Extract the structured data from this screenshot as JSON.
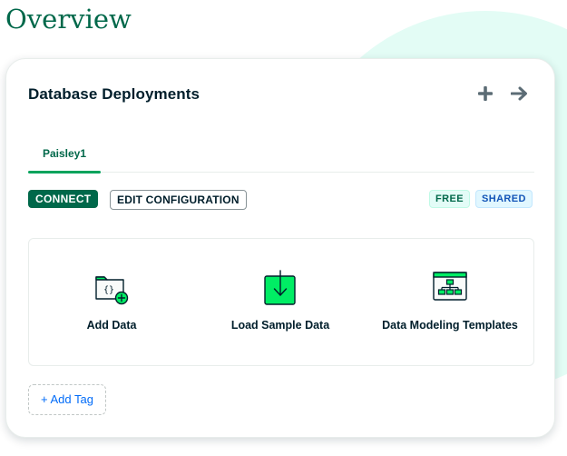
{
  "page": {
    "title": "Overview"
  },
  "deployments": {
    "title": "Database Deployments",
    "add_icon": "plus-icon",
    "view_all_icon": "arrow-right-icon",
    "tabs": [
      {
        "label": "Paisley1",
        "active": true
      }
    ],
    "actions": {
      "connect_label": "CONNECT",
      "edit_label": "EDIT CONFIGURATION"
    },
    "badges": {
      "free": "FREE",
      "shared": "SHARED"
    },
    "tiles": [
      {
        "label": "Add Data",
        "icon": "add-data-folder-icon"
      },
      {
        "label": "Load Sample Data",
        "icon": "download-arrow-icon"
      },
      {
        "label": "Data Modeling Templates",
        "icon": "hierarchy-diagram-icon"
      }
    ],
    "tag_label": "+ Add Tag"
  },
  "colors": {
    "brand_green": "#00684a",
    "accent_green": "#00ed64",
    "link_blue": "#016bf8",
    "text_dark": "#001e2b",
    "background_blob": "#e3fcf5"
  }
}
